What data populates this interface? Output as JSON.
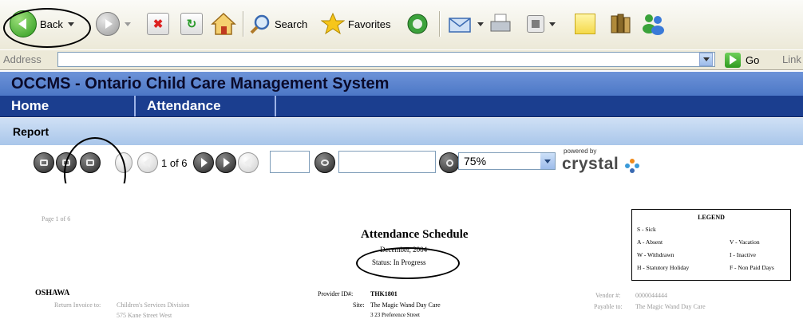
{
  "toolbar": {
    "back_label": "Back",
    "search_label": "Search",
    "favorites_label": "Favorites"
  },
  "address_bar": {
    "label": "Address",
    "value": "",
    "go_label": "Go",
    "links_label": "Link"
  },
  "app": {
    "title": "OCCMS - Ontario Child Care Management System",
    "nav": [
      {
        "label": "Home"
      },
      {
        "label": "Attendance"
      }
    ],
    "section_title": "Report"
  },
  "report_viewer": {
    "page_indicator": "1 of 6",
    "goto_page_value": "",
    "search_value": "",
    "zoom_value": "75%",
    "powered_by": "powered by",
    "brand": "crystal"
  },
  "document": {
    "page_label": "Page 1 of 6",
    "title": "Attendance Schedule",
    "period": "December, 2004",
    "status": "Status: In Progress",
    "city": "OSHAWA",
    "return_label": "Return Invoice to:",
    "return_org": "Children's Services Division",
    "return_addr": "575 Kane Street West",
    "provider_label": "Provider ID#:",
    "provider_id": "THK1801",
    "site_label": "Site:",
    "site_value": "The Magic Wand Day Care",
    "site_addr": "3 23 Preference Street",
    "vendor_label": "Vendor #:",
    "vendor_value": "0000044444",
    "payable_label": "Payable to:",
    "payable_value": "The Magic Wand Day Care",
    "legend": {
      "title": "LEGEND",
      "items": [
        "S - Sick",
        "A - Absent",
        "V - Vacation",
        "W - Withdrawn",
        "I - Inactive",
        "H - Statutory Holiday",
        "F - Non Paid Days"
      ]
    }
  },
  "colors": {
    "title_bar": "#5a82cf",
    "nav_bar": "#1b3e8f",
    "report_bar": "#bcd4f0"
  }
}
